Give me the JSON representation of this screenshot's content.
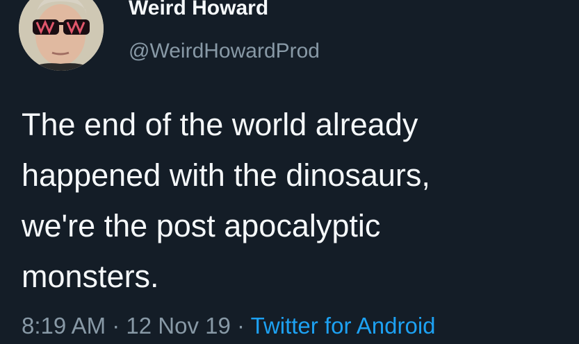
{
  "user": {
    "display_name": "Weird Howard",
    "handle": "@WeirdHowardProd",
    "avatar_icon": "profile-photo-sunglasses"
  },
  "tweet": {
    "lines": [
      "The end of the world already",
      "happened with the dinosaurs,",
      "we're the post apocalyptic",
      "monsters."
    ]
  },
  "meta": {
    "time": "8:19 AM",
    "separator": " · ",
    "date": "12 Nov 19",
    "source": "Twitter for Android"
  },
  "colors": {
    "background": "#15202b",
    "text_primary": "#f5f8fa",
    "text_secondary": "#8899a6",
    "link": "#1da1f2"
  }
}
